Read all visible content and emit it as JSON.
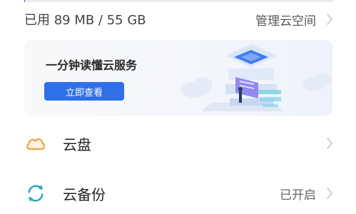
{
  "storage": {
    "used_text": "已用 89 MB / 55 GB",
    "used_fraction": 0.0016,
    "manage_label": "管理云空间"
  },
  "banner": {
    "title": "一分钟读懂云服务",
    "button_label": "立即查看"
  },
  "list": [
    {
      "label": "云盘",
      "status": ""
    },
    {
      "label": "云备份",
      "status": "已开启"
    }
  ],
  "colors": {
    "accent": "#2f6fe8",
    "cloud_icon": "#f0a33b",
    "backup_icon": "#29a3c9",
    "chevron": "#c4c4c4"
  },
  "icons": {
    "cloud_drive": "cloud-icon",
    "backup": "sync-icon",
    "chevron": "chevron-right-icon"
  }
}
